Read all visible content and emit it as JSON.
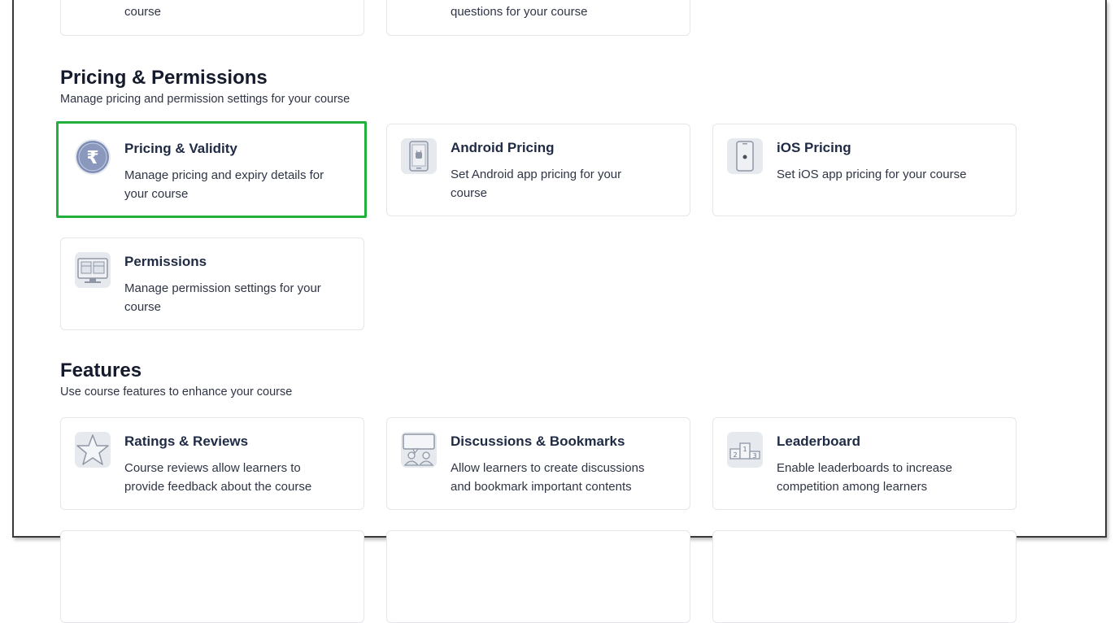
{
  "top_partial": {
    "card1_desc_tail": "course",
    "card2_desc_tail": "questions for your course"
  },
  "pricing_section": {
    "title": "Pricing & Permissions",
    "subtitle": "Manage pricing and permission settings for your course",
    "cards": [
      {
        "title": "Pricing & Validity",
        "desc": "Manage pricing and expiry details for your course",
        "icon": "rupee-icon",
        "selected": true
      },
      {
        "title": "Android Pricing",
        "desc": "Set Android app pricing for your course",
        "icon": "android-phone-icon"
      },
      {
        "title": "iOS Pricing",
        "desc": "Set iOS app pricing for your course",
        "icon": "iphone-icon"
      },
      {
        "title": "Permissions",
        "desc": "Manage permission settings for your course",
        "icon": "monitor-icon"
      }
    ]
  },
  "features_section": {
    "title": "Features",
    "subtitle": "Use course features to enhance your course",
    "cards": [
      {
        "title": "Ratings & Reviews",
        "desc": "Course reviews allow learners to provide feedback about the course",
        "icon": "star-icon"
      },
      {
        "title": "Discussions & Bookmarks",
        "desc": "Allow learners to create discussions and bookmark important contents",
        "icon": "discussion-icon"
      },
      {
        "title": "Leaderboard",
        "desc": "Enable leaderboards to increase competition among learners",
        "icon": "podium-icon"
      }
    ]
  },
  "colors": {
    "selected_border": "#22b03c",
    "card_border": "#e4e6ea",
    "icon_bg": "#e6e9ee",
    "title_text": "#1f2a44"
  }
}
